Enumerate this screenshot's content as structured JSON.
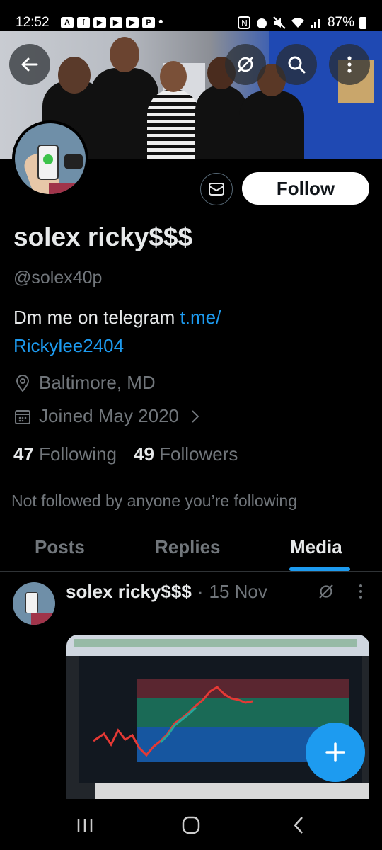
{
  "status_bar": {
    "time": "12:52",
    "battery": "87%",
    "notification_icons": [
      "A",
      "f",
      "▶",
      "▶",
      "▶",
      "P",
      "•"
    ]
  },
  "profile": {
    "name": "solex ricky$$$",
    "handle": "@solex40p",
    "bio_text": "Dm me on telegram ",
    "bio_link_part1": "t.me/",
    "bio_link_part2": "Rickylee2404",
    "location": "Baltimore, MD",
    "joined": "Joined May 2020",
    "following_count": "47",
    "following_label": "Following",
    "followers_count": "49",
    "followers_label": "Followers",
    "not_followed_text": "Not followed by anyone you’re following"
  },
  "actions": {
    "follow_label": "Follow"
  },
  "tabs": [
    {
      "label": "Posts"
    },
    {
      "label": "Replies"
    },
    {
      "label": "Media",
      "active": true
    }
  ],
  "post": {
    "author": "solex ricky$$$",
    "separator": "·",
    "date": "15 Nov"
  },
  "colors": {
    "accent": "#1d9bf0",
    "background": "#000000",
    "secondary_text": "#71767b"
  },
  "icons": [
    "back-arrow-icon",
    "grok-icon",
    "search-icon",
    "more-vertical-icon",
    "mail-icon",
    "location-pin-icon",
    "calendar-icon",
    "chevron-right-icon",
    "plus-icon"
  ]
}
